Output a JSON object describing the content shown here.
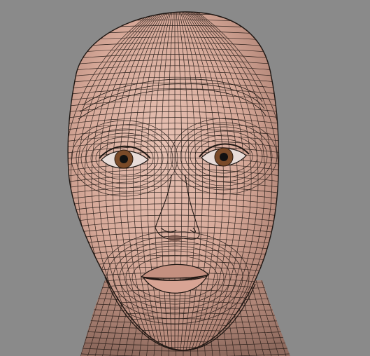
{
  "viewport": {
    "background_color": "#8a8a8a"
  },
  "model": {
    "subject": "head-wireframe-mesh",
    "skin_color": "#d6a898",
    "skin_shadow_color": "#b88a7c",
    "wire_color": "#1e1612",
    "eye_iris_color": "#7a4a28",
    "pupil_color": "#111111"
  }
}
